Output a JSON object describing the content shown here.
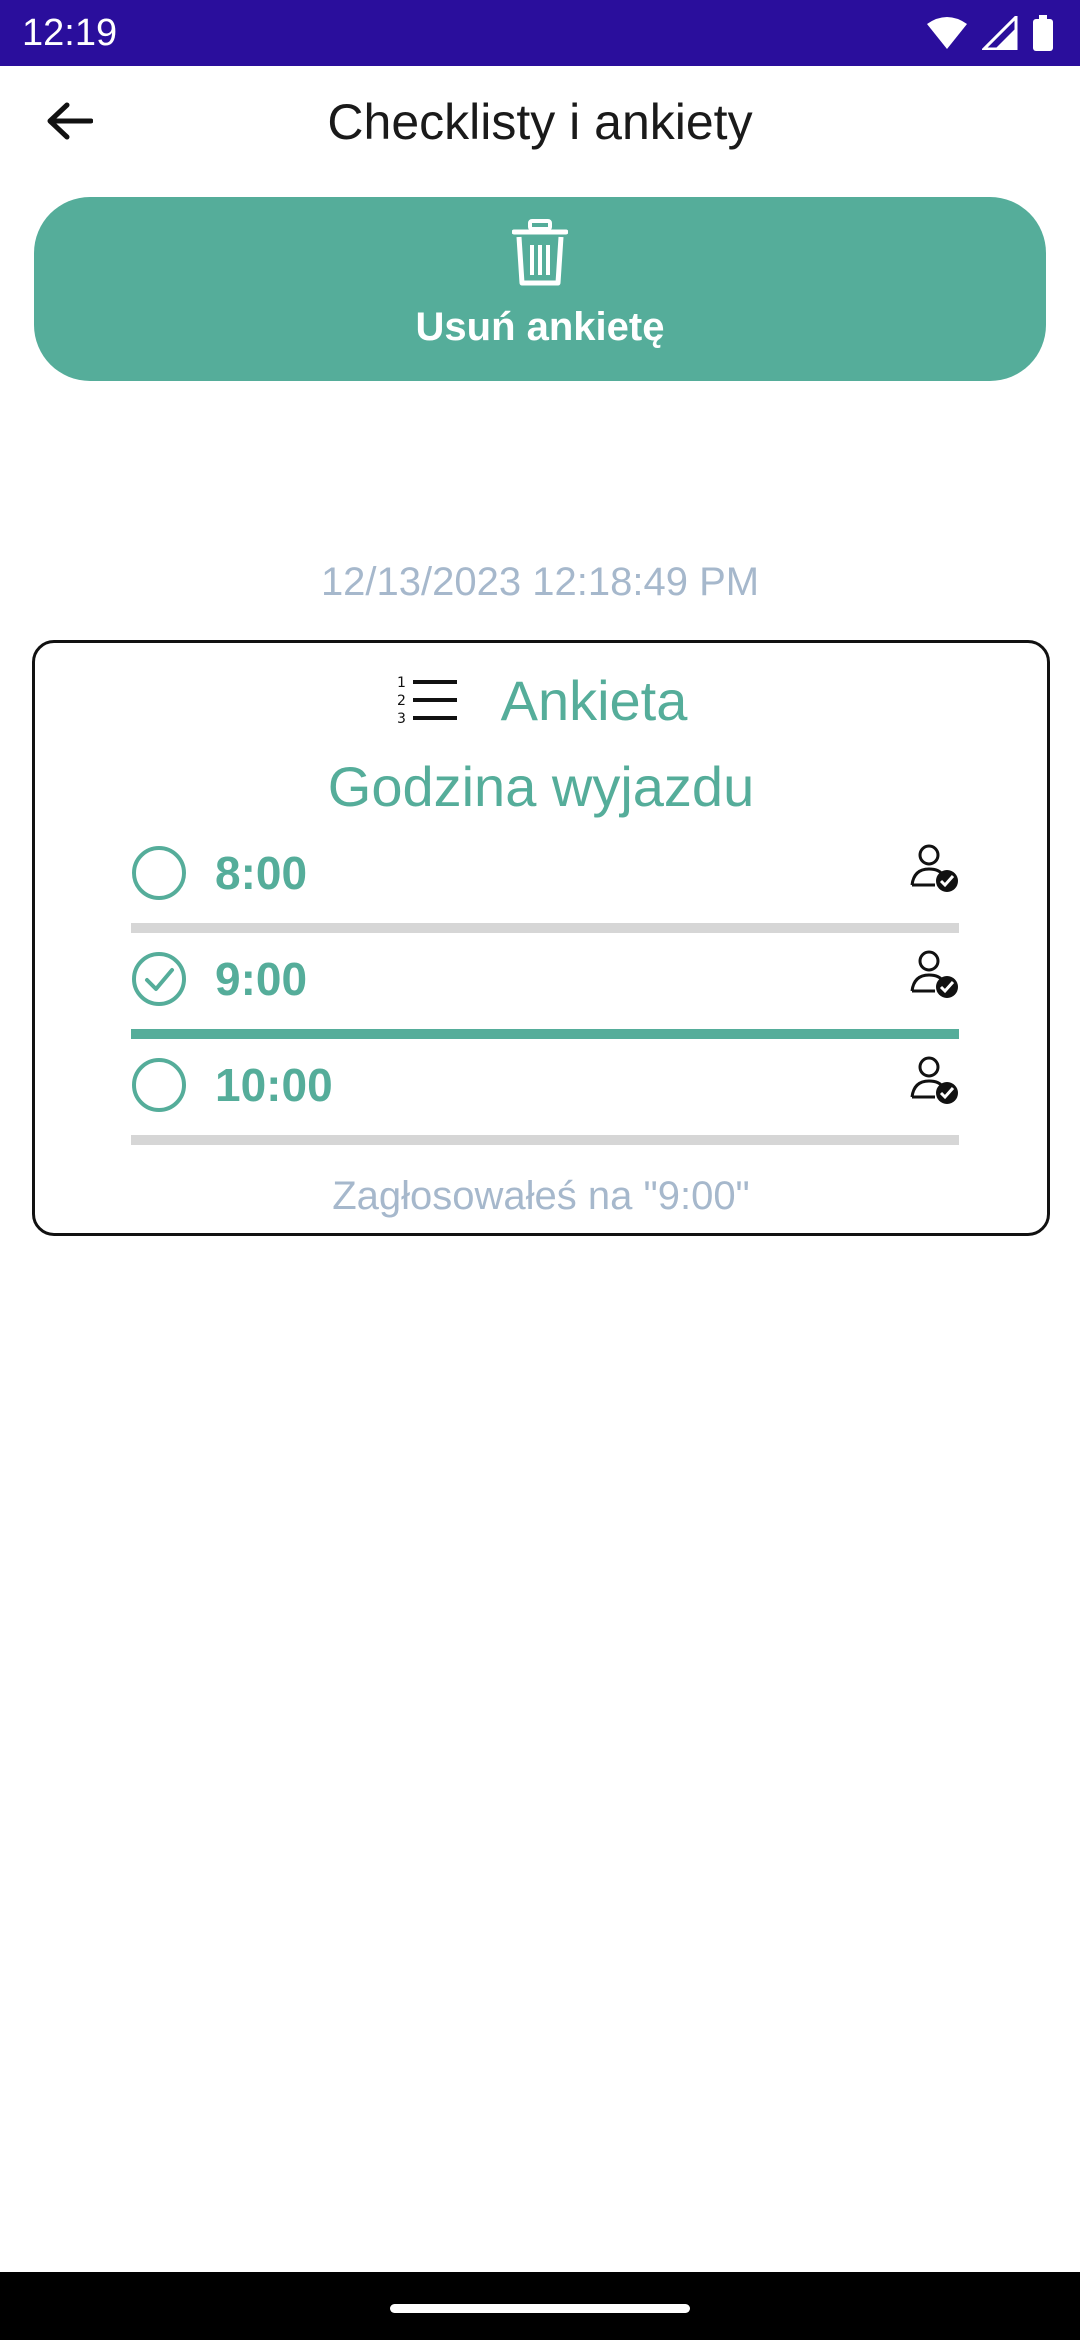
{
  "status_bar": {
    "time": "12:19",
    "icons": [
      "wifi-icon",
      "signal-icon",
      "battery-icon"
    ]
  },
  "app_bar": {
    "title": "Checklisty i ankiety",
    "back_icon": "arrow-left-icon"
  },
  "actions": {
    "delete_label": "Usuń ankietę",
    "delete_icon": "trash-icon"
  },
  "timestamp": "12/13/2023 12:18:49 PM",
  "poll": {
    "type_label": "Ankieta",
    "type_icon": "numbered-list-icon",
    "question": "Godzina wyjazdu",
    "options": [
      {
        "label": "8:00",
        "selected": false,
        "vote_fraction": 0
      },
      {
        "label": "9:00",
        "selected": true,
        "vote_fraction": 1
      },
      {
        "label": "10:00",
        "selected": false,
        "vote_fraction": 0
      }
    ],
    "vote_info": "Zagłosowałeś na \"9:00\""
  },
  "colors": {
    "accent": "#55ad9a",
    "status_bar": "#2a0e9c",
    "muted_text": "#a6b8cc"
  }
}
